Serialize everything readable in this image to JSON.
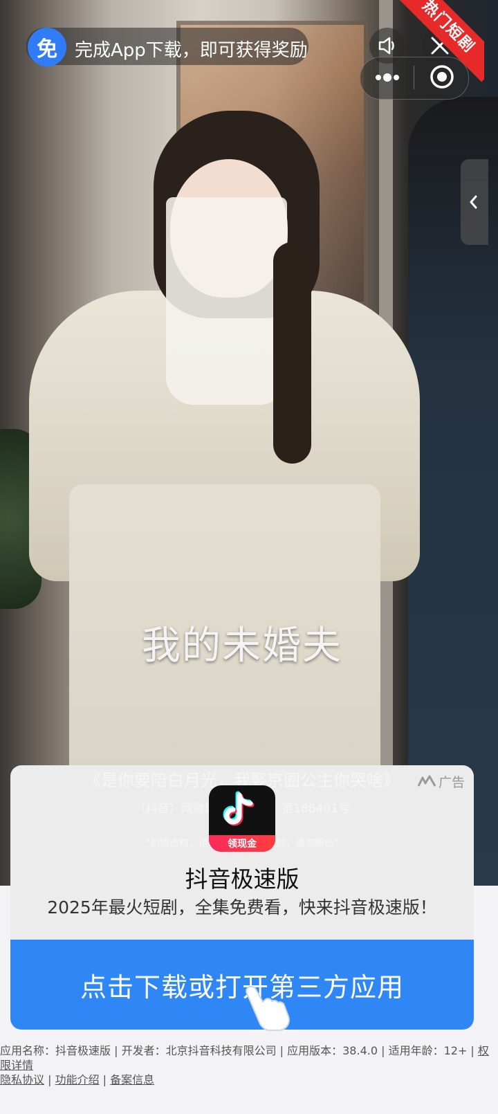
{
  "top_bar": {
    "badge_text": "免",
    "promo_text": "完成App下载，即可获得奖励",
    "ribbon_text": "热门短剧"
  },
  "video": {
    "subtitle": "我的未婚夫",
    "ghost_title": "《是你要陪白月光，我娶京圈公主你哭啥》",
    "ghost_line2": "（抖音）网微剧审（2025）第188401号",
    "ghost_line3": "\"剧情虚构，请勿模仿，理性追剧，请勿模仿\""
  },
  "ad": {
    "label": "广告",
    "icon_band": "领现金",
    "app_name": "抖音极速版",
    "description": "2025年最火短剧，全集免费看，快来抖音极速版！",
    "cta": "点击下载或打开第三方应用"
  },
  "footer": {
    "app_info": "应用名称：抖音极速版 | 开发者：北京抖音科技有限公司 | 应用版本：38.4.0 | 适用年龄：12+ | ",
    "permissions": "权限详情",
    "privacy": "隐私协议",
    "features": "功能介绍",
    "filing": "备案信息",
    "sep": " | "
  },
  "colors": {
    "cta_blue": "#2f86f5",
    "badge_blue": "#2f7cf6",
    "ribbon_red": "#e62a2a"
  }
}
